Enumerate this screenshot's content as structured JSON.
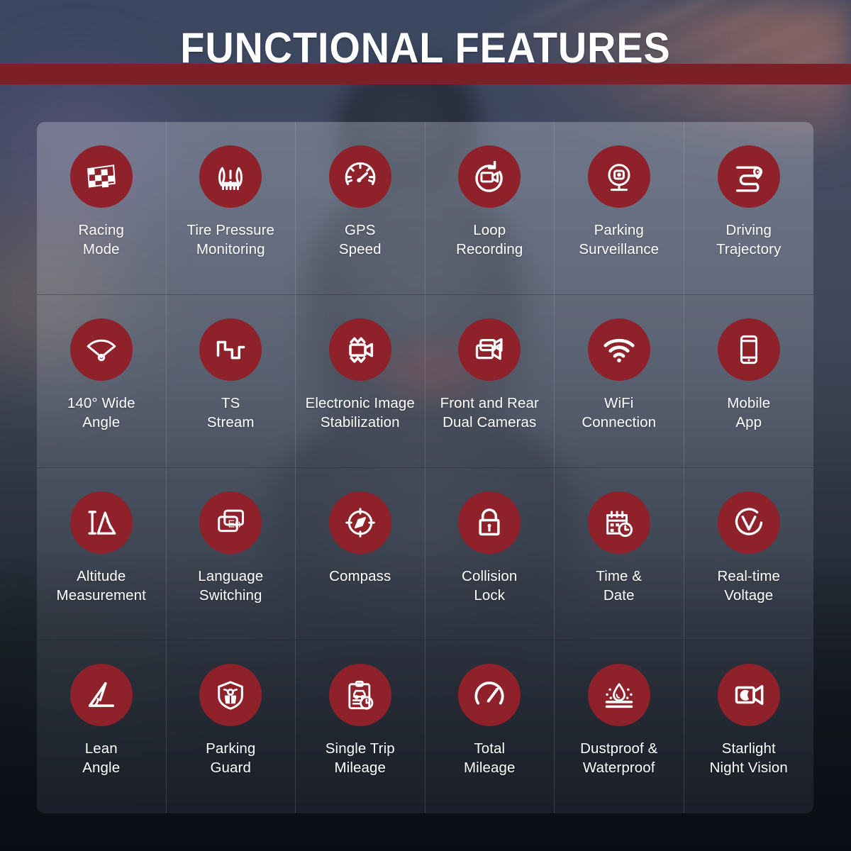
{
  "header": {
    "title": "FUNCTIONAL FEATURES",
    "band_color": "#7D1F26"
  },
  "theme": {
    "icon_circle_color": "#8E2129",
    "icon_glyph_color": "#FFFFFF",
    "label_color": "#FFFFFF",
    "panel_tint": "rgba(200,206,220,0.30)"
  },
  "features": [
    {
      "icon": "checkered-flag-icon",
      "label": "Racing\nMode"
    },
    {
      "icon": "tire-pressure-icon",
      "label": "Tire Pressure\nMonitoring"
    },
    {
      "icon": "speedometer-icon",
      "label": "GPS\nSpeed"
    },
    {
      "icon": "loop-recording-icon",
      "label": "Loop\nRecording"
    },
    {
      "icon": "surveillance-camera-icon",
      "label": "Parking\nSurveillance"
    },
    {
      "icon": "route-pin-icon",
      "label": "Driving\nTrajectory"
    },
    {
      "icon": "wide-angle-icon",
      "label": "140° Wide\nAngle"
    },
    {
      "icon": "square-wave-icon",
      "label": "TS\nStream"
    },
    {
      "icon": "stabilized-camera-icon",
      "label": "Electronic Image\nStabilization"
    },
    {
      "icon": "dual-camera-icon",
      "label": "Front and Rear\nDual Cameras"
    },
    {
      "icon": "wifi-icon",
      "label": "WiFi\nConnection"
    },
    {
      "icon": "smartphone-icon",
      "label": "Mobile\nApp"
    },
    {
      "icon": "altitude-mountain-icon",
      "label": "Altitude\nMeasurement"
    },
    {
      "icon": "language-en-icon",
      "label": "Language\nSwitching"
    },
    {
      "icon": "compass-icon",
      "label": "Compass"
    },
    {
      "icon": "padlock-icon",
      "label": "Collision\nLock"
    },
    {
      "icon": "calendar-clock-icon",
      "label": "Time &\nDate"
    },
    {
      "icon": "voltage-circle-icon",
      "label": "Real-time\nVoltage"
    },
    {
      "icon": "lean-angle-icon",
      "label": "Lean\nAngle"
    },
    {
      "icon": "shield-scooter-icon",
      "label": "Parking\nGuard"
    },
    {
      "icon": "clipboard-car-clock-icon",
      "label": "Single Trip\nMileage"
    },
    {
      "icon": "gauge-icon",
      "label": "Total\nMileage"
    },
    {
      "icon": "water-dust-icon",
      "label": "Dustproof &\nWaterproof"
    },
    {
      "icon": "night-vision-camera-icon",
      "label": "Starlight\nNight Vision"
    }
  ]
}
